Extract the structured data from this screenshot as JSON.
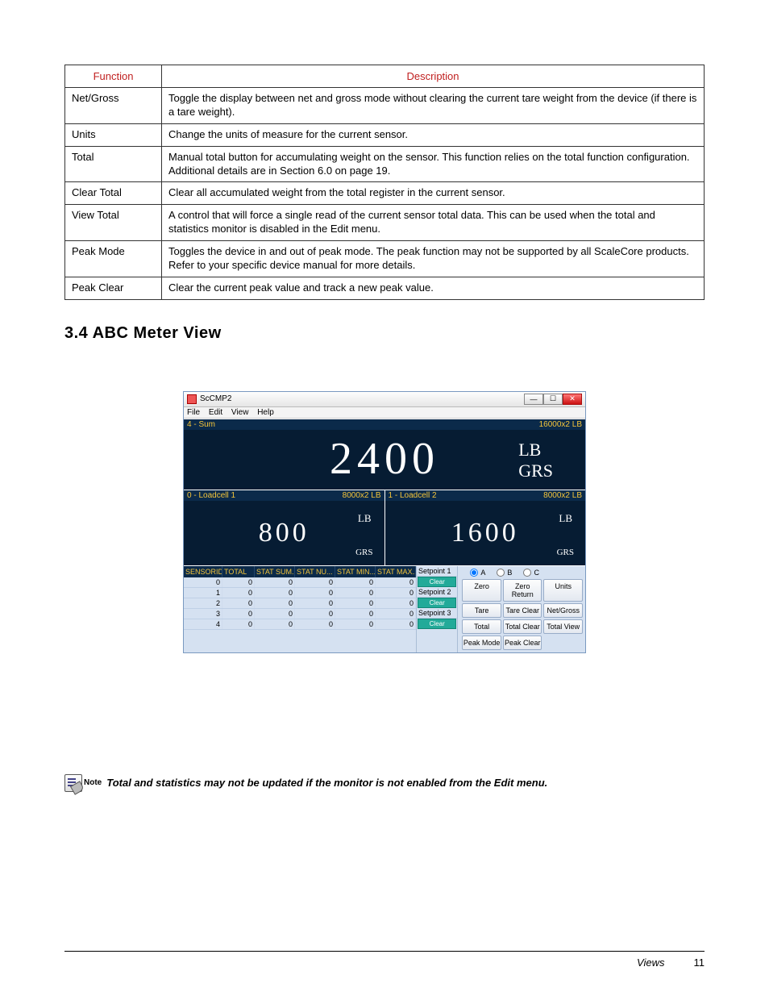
{
  "table": {
    "headers": {
      "col1": "Function",
      "col2": "Description"
    },
    "rows": [
      {
        "fn": "Net/Gross",
        "desc": "Toggle the display between net and gross mode without clearing the current tare weight from the device (if there is a tare weight)."
      },
      {
        "fn": "Units",
        "desc": "Change the units of measure for the current sensor."
      },
      {
        "fn": "Total",
        "desc": "Manual total button for accumulating weight on the sensor. This function relies on the total function configuration.  Additional details are in Section 6.0 on page 19."
      },
      {
        "fn": "Clear Total",
        "desc": "Clear all accumulated weight from the total register in the current sensor."
      },
      {
        "fn": "View Total",
        "desc": "A control that will force a single read of the current sensor total data.  This can be used when the total and statistics monitor is disabled in the Edit menu."
      },
      {
        "fn": "Peak Mode",
        "desc": "Toggles the device in and out of peak mode. The peak function may not be supported by all ScaleCore products.  Refer to your specific device manual for more details."
      },
      {
        "fn": "Peak Clear",
        "desc": "Clear the current peak value and track a new peak value."
      }
    ]
  },
  "heading": "3.4  ABC Meter View",
  "app": {
    "title": "ScCMP2",
    "menubar": [
      "File",
      "Edit",
      "View",
      "Help"
    ],
    "sum": {
      "label": "4 - Sum",
      "range": "16000x2 LB",
      "value": "2400",
      "unit": "LB",
      "mode": "GRS"
    },
    "lc": [
      {
        "label": "0 - Loadcell 1",
        "range": "8000x2 LB",
        "value": "800",
        "unit": "LB",
        "mode": "GRS"
      },
      {
        "label": "1 - Loadcell 2",
        "range": "8000x2 LB",
        "value": "1600",
        "unit": "LB",
        "mode": "GRS"
      }
    ],
    "stats": {
      "headers": [
        "SENSORID",
        "TOTAL",
        "STAT SUM...",
        "STAT NU...",
        "STAT MIN...",
        "STAT MAX..."
      ],
      "rows": [
        [
          "0",
          "0",
          "0",
          "0",
          "0",
          "0"
        ],
        [
          "1",
          "0",
          "0",
          "0",
          "0",
          "0"
        ],
        [
          "2",
          "0",
          "0",
          "0",
          "0",
          "0"
        ],
        [
          "3",
          "0",
          "0",
          "0",
          "0",
          "0"
        ],
        [
          "4",
          "0",
          "0",
          "0",
          "0",
          "0"
        ]
      ]
    },
    "setpoints": {
      "items": [
        "Setpoint 1",
        "Setpoint 2",
        "Setpoint 3"
      ],
      "clear": "Clear"
    },
    "radios": {
      "a": "A",
      "b": "B",
      "c": "C"
    },
    "buttons": {
      "zero": "Zero",
      "zeroReturn": "Zero Return",
      "units": "Units",
      "tare": "Tare",
      "tareClear": "Tare Clear",
      "netGross": "Net/Gross",
      "total": "Total",
      "totalClear": "Total Clear",
      "totalView": "Total View",
      "peakMode": "Peak Mode",
      "peakClear": "Peak Clear"
    }
  },
  "note": {
    "label": "Note",
    "text": "Total and statistics may not be updated if the monitor is not enabled from the Edit menu."
  },
  "footer": {
    "section": "Views",
    "page": "11"
  }
}
